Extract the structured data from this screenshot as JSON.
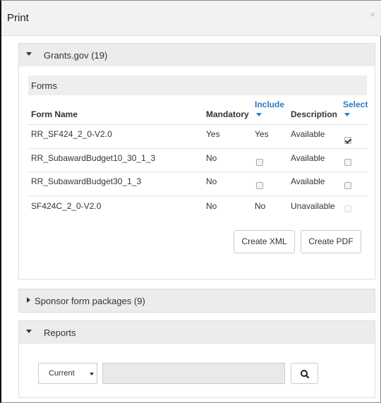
{
  "dialog": {
    "title": "Print",
    "close_glyph": "×"
  },
  "grants_panel": {
    "title": "Grants.gov (19)",
    "forms_section_label": "Forms",
    "columns": {
      "form_name": "Form Name",
      "mandatory": "Mandatory",
      "include": "Include",
      "description": "Description",
      "select": "Select"
    },
    "rows": [
      {
        "form_name": "RR_SF424_2_0-V2.0",
        "mandatory": "Yes",
        "include": "Yes",
        "include_checkbox": false,
        "description": "Available",
        "select_checked": true,
        "select_disabled": false
      },
      {
        "form_name": "RR_SubawardBudget10_30_1_3",
        "mandatory": "No",
        "include": "",
        "include_checkbox": true,
        "description": "Available",
        "select_checked": false,
        "select_disabled": false
      },
      {
        "form_name": "RR_SubawardBudget30_1_3",
        "mandatory": "No",
        "include": "",
        "include_checkbox": true,
        "description": "Available",
        "select_checked": false,
        "select_disabled": false
      },
      {
        "form_name": "SF424C_2_0-V2.0",
        "mandatory": "No",
        "include": "No",
        "include_checkbox": false,
        "description": "Unavailable",
        "select_checked": false,
        "select_disabled": true
      }
    ],
    "buttons": {
      "create_xml": "Create XML",
      "create_pdf": "Create PDF"
    }
  },
  "sponsor_panel": {
    "title": "Sponsor form packages (9)"
  },
  "reports_panel": {
    "title": "Reports",
    "filter_selected": "Current",
    "search_value": "",
    "icons": {
      "search": "search-icon"
    }
  }
}
